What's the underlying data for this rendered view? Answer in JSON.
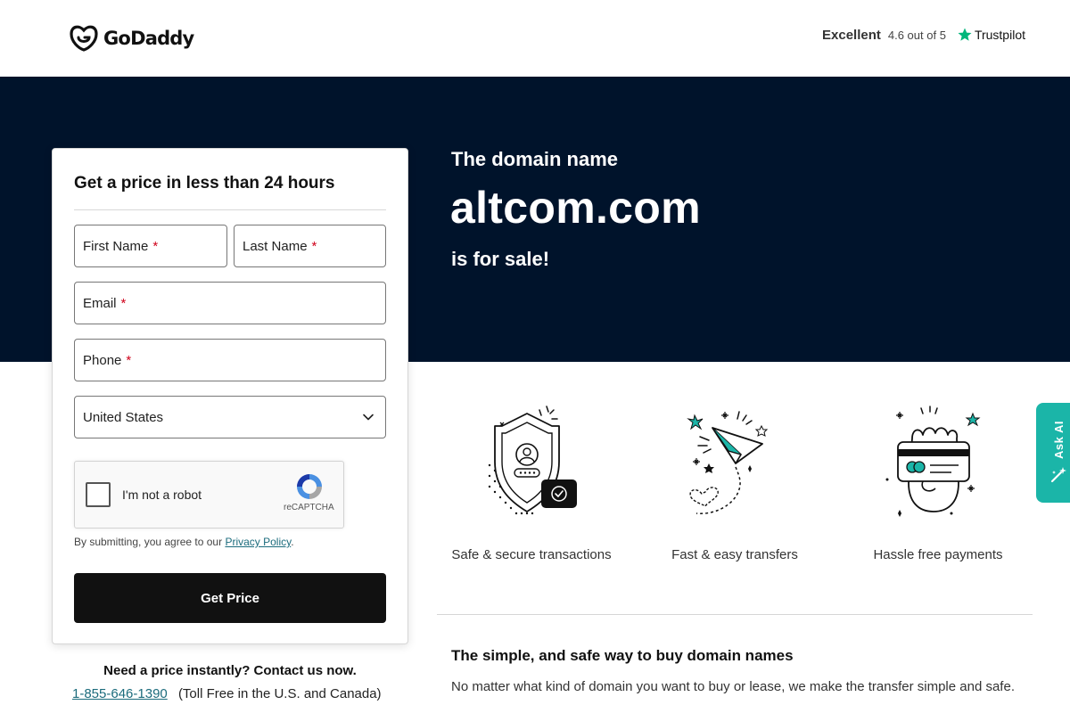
{
  "header": {
    "logo_text": "GoDaddy",
    "rating_word": "Excellent",
    "rating_score": "4.6 out of 5",
    "rating_brand": "Trustpilot"
  },
  "hero": {
    "lead": "The domain name",
    "domain": "altcom.com",
    "tail": "is for sale!"
  },
  "form": {
    "title": "Get a price in less than 24 hours",
    "first_name": "First Name",
    "last_name": "Last Name",
    "email": "Email",
    "phone": "Phone",
    "required_mark": "*",
    "country_value": "United States",
    "recaptcha_label": "I'm not a robot",
    "recaptcha_brand": "reCAPTCHA",
    "consent_prefix": "By submitting, you agree to our ",
    "consent_link": "Privacy Policy",
    "consent_suffix": ".",
    "submit_label": "Get Price"
  },
  "contact": {
    "title": "Need a price instantly? Contact us now.",
    "phone": "1-855-646-1390",
    "note": "(Toll Free in the U.S. and Canada)"
  },
  "features": [
    {
      "label": "Safe & secure transactions",
      "icon": "shield-user-icon"
    },
    {
      "label": "Fast & easy transfers",
      "icon": "paper-plane-icon"
    },
    {
      "label": "Hassle free payments",
      "icon": "hand-card-icon"
    }
  ],
  "info": {
    "title": "The simple, and safe way to buy domain names",
    "body": "No matter what kind of domain you want to buy or lease, we make the transfer simple and safe."
  },
  "side_tab": {
    "label": "Ask AI"
  },
  "colors": {
    "hero_bg": "#00132b",
    "accent_teal": "#1bb5a8",
    "link": "#1b6b7c",
    "required": "#d0021b",
    "button": "#111111"
  }
}
